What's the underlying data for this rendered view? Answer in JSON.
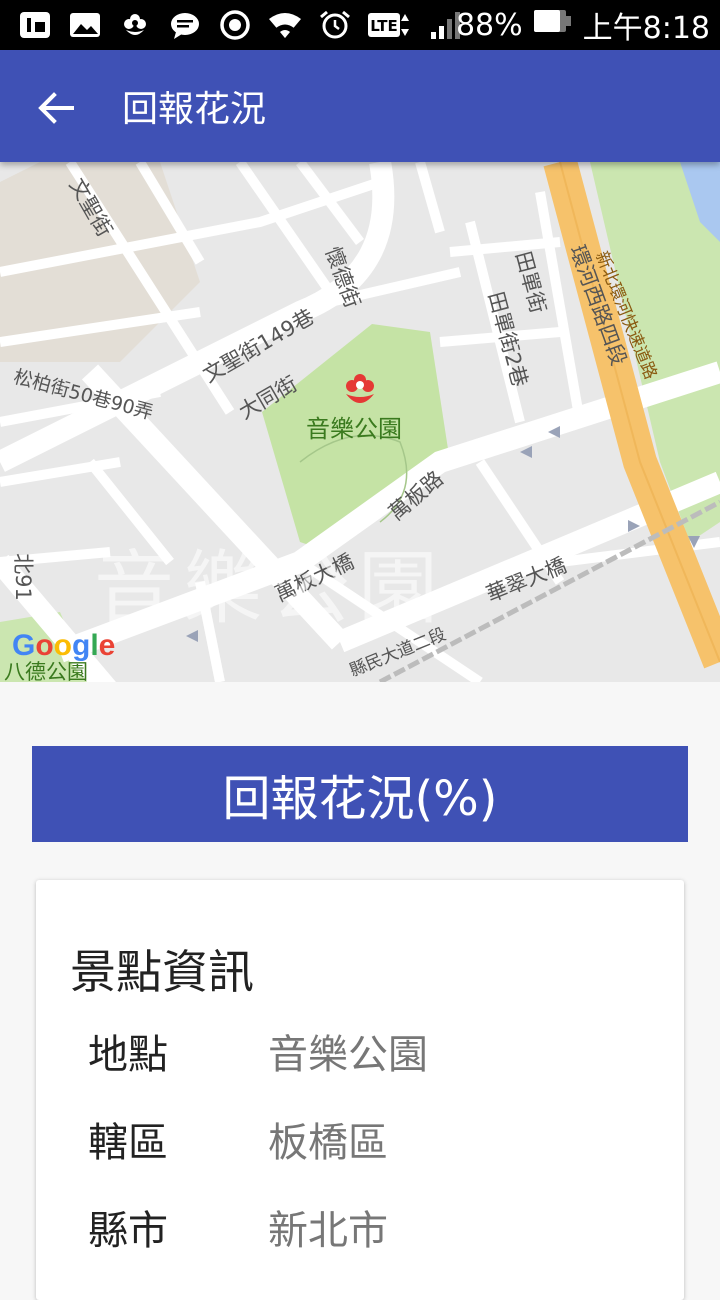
{
  "status_bar": {
    "battery_percent": "88%",
    "time": "上午8:18",
    "network": "LTE",
    "icons": [
      "sim-icon",
      "gallery-icon",
      "flower-icon",
      "chat-icon",
      "record-icon",
      "wifi-icon",
      "alarm-icon",
      "lte-icon",
      "signal-icon",
      "battery-icon"
    ]
  },
  "app_bar": {
    "title": "回報花況",
    "back_icon": "arrow-back-icon"
  },
  "map": {
    "park_name": "音樂公園",
    "watermark": "音樂公園",
    "logo": "Google",
    "labels": {
      "wensheng_st": "文聖街",
      "huaide_st": "懷德街",
      "tianshan_st": "田單街",
      "tianshan_st2": "田單街2巷",
      "huanhe_w_rd": "環河西路四段",
      "expressway": "新北環河快速道路",
      "wensheng_lane": "文聖街149巷",
      "songbo_lane": "松柏街50巷90弄",
      "datong_st": "大同街",
      "wanban_rd": "萬板路",
      "wanban_bridge": "萬板大橋",
      "huacui_bridge": "華翠大橋",
      "county_blvd": "縣民大道二段",
      "route_91": "北91",
      "bade_park": "八德公園"
    }
  },
  "banner": {
    "label": "回報花況(%)"
  },
  "info_card": {
    "title": "景點資訊",
    "rows": [
      {
        "label": "地點",
        "value": "音樂公園"
      },
      {
        "label": "轄區",
        "value": "板橋區"
      },
      {
        "label": "縣市",
        "value": "新北市"
      }
    ]
  },
  "colors": {
    "primary": "#3f51b5",
    "park_green": "#c5e3a5",
    "highway_orange": "#f6c26b",
    "marker_red": "#e53935"
  }
}
